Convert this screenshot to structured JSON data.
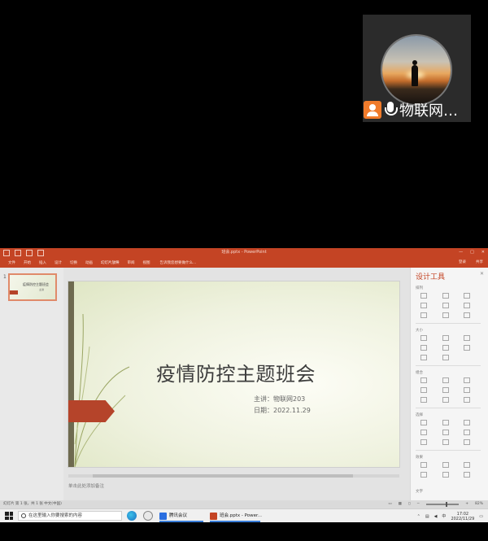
{
  "video_call": {
    "participant_name": "物联网…"
  },
  "powerpoint": {
    "window_title": "班会.pptx - PowerPoint",
    "quick_access": [
      "save",
      "undo",
      "redo",
      "start-from-beginning"
    ],
    "tabs": [
      "文件",
      "开始",
      "插入",
      "设计",
      "切换",
      "动画",
      "幻灯片放映",
      "审阅",
      "视图"
    ],
    "active_tab": "幻灯片放映",
    "tell_me": "告诉我您想要做什么...",
    "ribbon_right": {
      "signin": "登录",
      "share": "共享"
    },
    "window_controls": [
      "—",
      "□",
      "✕"
    ],
    "thumbnail": {
      "number": "1",
      "title": "疫情防控主题班会",
      "subtitle": "主讲"
    },
    "slide": {
      "title": "疫情防控主题班会",
      "presenter": "主讲：物联网203",
      "date": "日期：2022.11.29",
      "accent_color": "#b5442a"
    },
    "notes_placeholder": "单击此处添加备注",
    "design_pane": {
      "title": "设计工具",
      "close": "✕",
      "groups": [
        "排列",
        "大小",
        "组合",
        "选择",
        "效果",
        "文字"
      ]
    },
    "statusbar": {
      "left": "幻灯片 第 1 张，共 1 张    中文(中国)",
      "zoom": "82%"
    }
  },
  "taskbar": {
    "search_placeholder": "在这里输入你要搜索的内容",
    "items": [
      {
        "label": "腾讯会议",
        "icon": "tencent-meeting-icon"
      },
      {
        "label": "班会.pptx - Power...",
        "icon": "powerpoint-icon"
      }
    ],
    "clock_time": "17:02",
    "clock_date": "2022/11/29"
  }
}
